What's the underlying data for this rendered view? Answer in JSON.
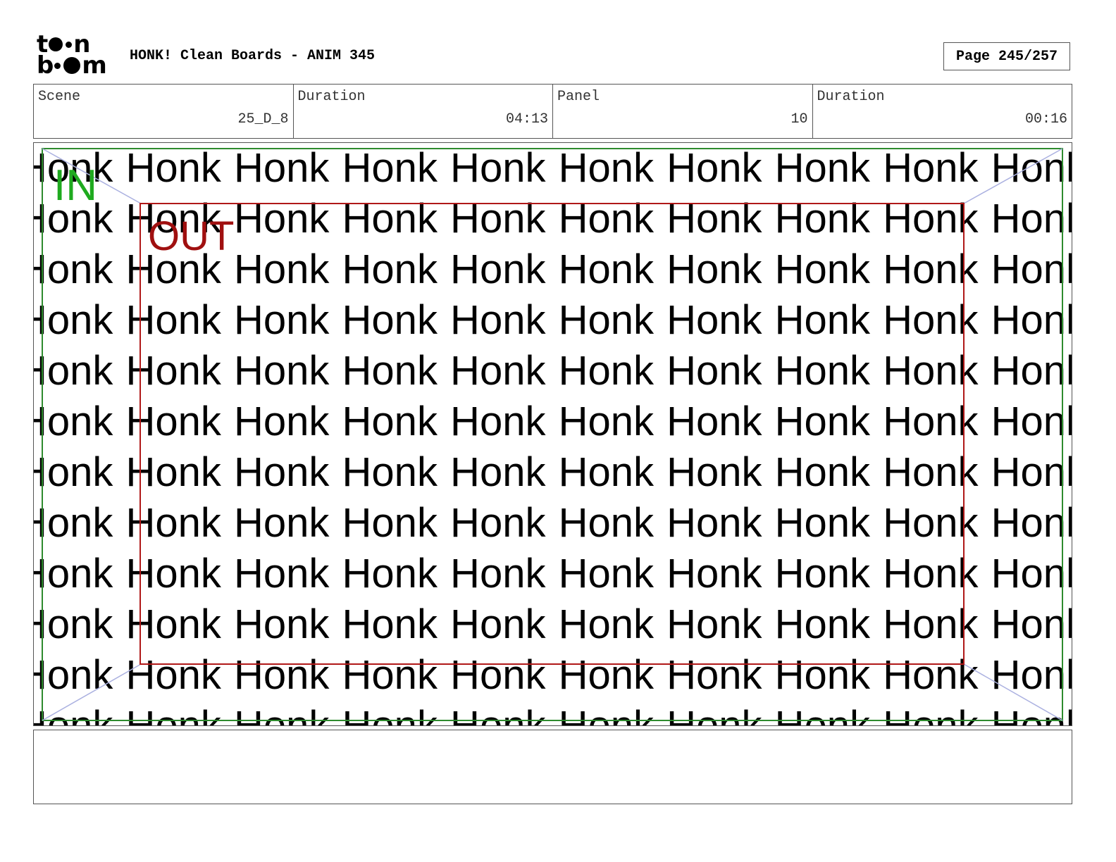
{
  "header": {
    "logo_top": "t n",
    "logo_bottom": "b m",
    "title": "HONK! Clean Boards - ANIM 345",
    "page": "Page 245/257"
  },
  "info": {
    "scene_label": "Scene",
    "scene_value": "25_D_8",
    "scene_duration_label": "Duration",
    "scene_duration_value": "04:13",
    "panel_label": "Panel",
    "panel_value": "10",
    "panel_duration_label": "Duration",
    "panel_duration_value": "00:16"
  },
  "panel": {
    "repeated_word": "Honk",
    "in_label": "IN",
    "out_label": "OUT",
    "in_color": "#1faa1f",
    "out_color": "#a01010"
  },
  "caption": {
    "text": ""
  }
}
